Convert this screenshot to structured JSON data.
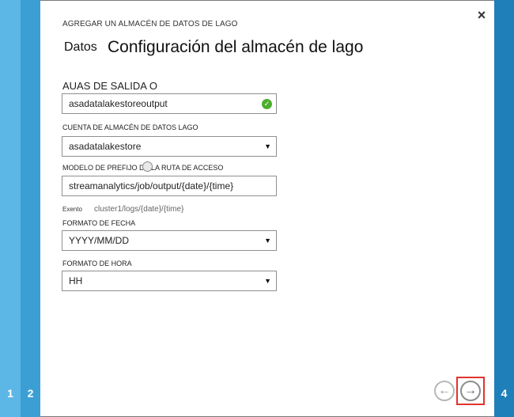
{
  "wizard": {
    "steps": [
      {
        "label": "1"
      },
      {
        "label": "2"
      },
      {
        "label": "4"
      }
    ],
    "close_icon": "close-icon",
    "header": "AGREGAR UN ALMACÉN DE DATOS DE LAGO",
    "title_prefix": "Datos",
    "title": "Configuración del almacén de lago"
  },
  "form": {
    "output_alias": {
      "label": "AUAS DE SALIDA O",
      "value": "asadatalakestoreoutput",
      "status_icon": "check-circle-icon",
      "status_color": "#4cae2e"
    },
    "account": {
      "label": "CUENTA DE ALMACÉN DE DATOS LAGO",
      "value": "asadatalakestore"
    },
    "path_prefix": {
      "label": "MODELO DE PREFIJO DE LA RUTA DE ACCESO",
      "value": "streamanalytics/job/output/{date}/{time}",
      "example_label": "Exento",
      "example_value": "cluster1/logs/{date}/{time}"
    },
    "date_format": {
      "label": "FORMATO DE FECHA",
      "value": "YYYY/MM/DD"
    },
    "time_format": {
      "label": "FORMATO DE HORA",
      "value": "HH"
    }
  },
  "navigation": {
    "prev_icon": "arrow-left-icon",
    "next_icon": "arrow-right-icon",
    "highlight_color": "#e0352b"
  }
}
